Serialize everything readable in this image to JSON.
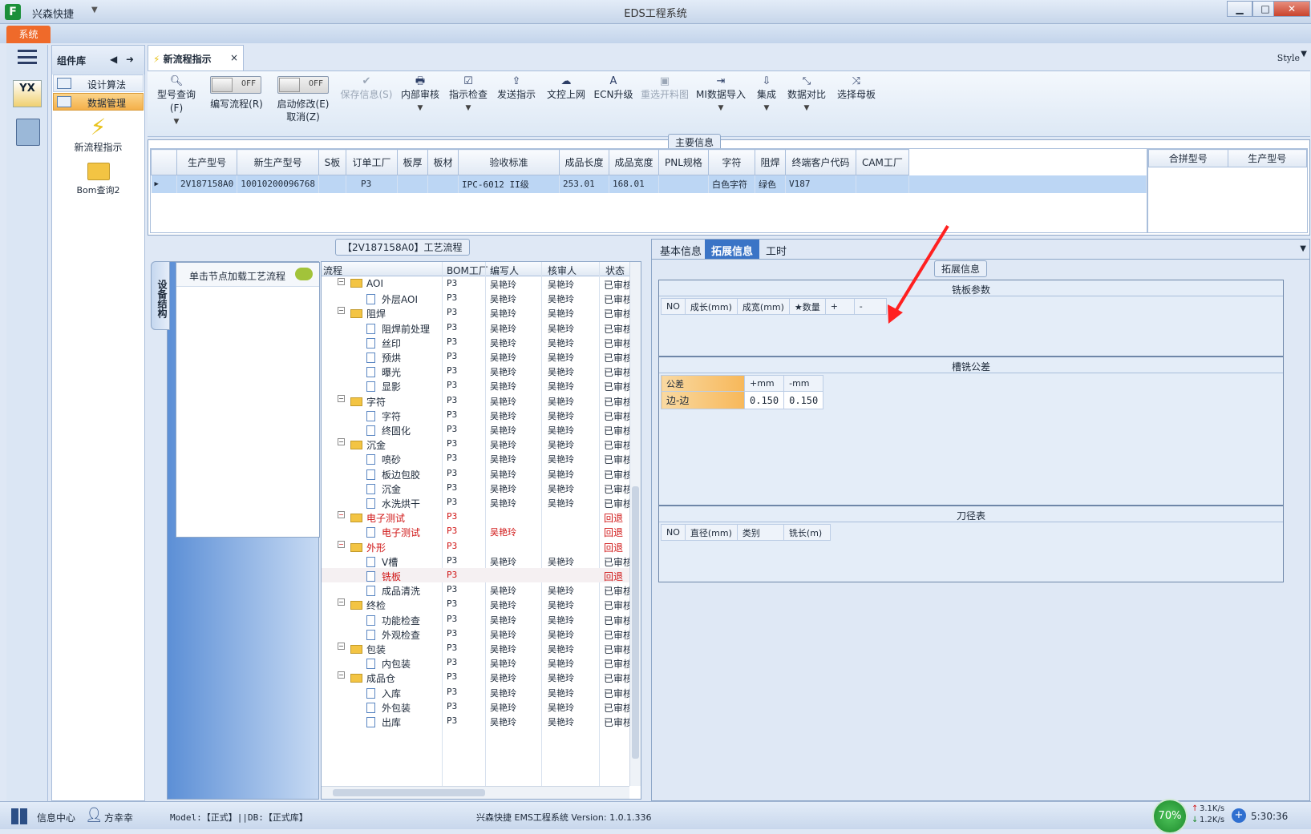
{
  "app": {
    "name": "兴森快捷",
    "window_title": "EDS工程系统",
    "menu_tab": "系统",
    "style_label": "Style"
  },
  "complib": {
    "title": "组件库",
    "items": [
      {
        "label": "设计算法"
      },
      {
        "label": "数据管理"
      }
    ],
    "big_items": [
      {
        "label": "新流程指示"
      },
      {
        "label": "Bom查询2"
      }
    ]
  },
  "doc_tab": {
    "label": "新流程指示",
    "close": "×"
  },
  "ribbon": {
    "buttons": [
      {
        "label": "型号查询(F)",
        "icon": "search-icon"
      },
      {
        "label": "编写流程(R)",
        "toggle": "OFF"
      },
      {
        "label": "启动修改(E)",
        "label2": "取消(Z)",
        "toggle": "OFF"
      },
      {
        "label": "保存信息(S)",
        "disabled": true
      },
      {
        "label": "内部审核"
      },
      {
        "label": "指示检查"
      },
      {
        "label": "发送指示"
      },
      {
        "label": "文控上网"
      },
      {
        "label": "ECN升级"
      },
      {
        "label": "重选开料图",
        "disabled": true
      },
      {
        "label": "MI数据导入"
      },
      {
        "label": "集成"
      },
      {
        "label": "数据对比"
      },
      {
        "label": "选择母板"
      }
    ]
  },
  "main_info": {
    "title": "主要信息",
    "columns": [
      "生产型号",
      "新生产型号",
      "S板",
      "订单工厂",
      "板厚",
      "板材",
      "验收标准",
      "成品长度",
      "成品宽度",
      "PNL规格",
      "字符",
      "阻焊",
      "终端客户代码",
      "CAM工厂"
    ],
    "row": [
      "2V187158A0",
      "10010200096768",
      "",
      "P3",
      "",
      "",
      "IPC-6012 II级",
      "253.01",
      "168.01",
      "",
      "白色字符",
      "绿色",
      "V187",
      ""
    ],
    "merge_columns": [
      "合拼型号",
      "生产型号"
    ]
  },
  "process": {
    "title": "【2V187158A0】工艺流程",
    "vertical_tab": "设备结构",
    "click_hint": "单击节点加载工艺流程",
    "columns": [
      "流程",
      "BOM工厂",
      "编写人",
      "核审人",
      "状态"
    ],
    "rows": [
      {
        "name": "AOI",
        "level": 0,
        "factory": "P3",
        "writer": "吴艳玲",
        "reviewer": "吴艳玲",
        "status": "已审核"
      },
      {
        "name": "外层AOI",
        "level": 1,
        "factory": "P3",
        "writer": "吴艳玲",
        "reviewer": "吴艳玲",
        "status": "已审核"
      },
      {
        "name": "阻焊",
        "level": 0,
        "factory": "P3",
        "writer": "吴艳玲",
        "reviewer": "吴艳玲",
        "status": "已审核"
      },
      {
        "name": "阻焊前处理",
        "level": 1,
        "factory": "P3",
        "writer": "吴艳玲",
        "reviewer": "吴艳玲",
        "status": "已审核"
      },
      {
        "name": "丝印",
        "level": 1,
        "factory": "P3",
        "writer": "吴艳玲",
        "reviewer": "吴艳玲",
        "status": "已审核"
      },
      {
        "name": "预烘",
        "level": 1,
        "factory": "P3",
        "writer": "吴艳玲",
        "reviewer": "吴艳玲",
        "status": "已审核"
      },
      {
        "name": "曝光",
        "level": 1,
        "factory": "P3",
        "writer": "吴艳玲",
        "reviewer": "吴艳玲",
        "status": "已审核"
      },
      {
        "name": "显影",
        "level": 1,
        "factory": "P3",
        "writer": "吴艳玲",
        "reviewer": "吴艳玲",
        "status": "已审核"
      },
      {
        "name": "字符",
        "level": 0,
        "factory": "P3",
        "writer": "吴艳玲",
        "reviewer": "吴艳玲",
        "status": "已审核"
      },
      {
        "name": "字符",
        "level": 1,
        "factory": "P3",
        "writer": "吴艳玲",
        "reviewer": "吴艳玲",
        "status": "已审核"
      },
      {
        "name": "终固化",
        "level": 1,
        "factory": "P3",
        "writer": "吴艳玲",
        "reviewer": "吴艳玲",
        "status": "已审核"
      },
      {
        "name": "沉金",
        "level": 0,
        "factory": "P3",
        "writer": "吴艳玲",
        "reviewer": "吴艳玲",
        "status": "已审核"
      },
      {
        "name": "喷砂",
        "level": 1,
        "factory": "P3",
        "writer": "吴艳玲",
        "reviewer": "吴艳玲",
        "status": "已审核"
      },
      {
        "name": "板边包胶",
        "level": 1,
        "factory": "P3",
        "writer": "吴艳玲",
        "reviewer": "吴艳玲",
        "status": "已审核"
      },
      {
        "name": "沉金",
        "level": 1,
        "factory": "P3",
        "writer": "吴艳玲",
        "reviewer": "吴艳玲",
        "status": "已审核"
      },
      {
        "name": "水洗烘干",
        "level": 1,
        "factory": "P3",
        "writer": "吴艳玲",
        "reviewer": "吴艳玲",
        "status": "已审核"
      },
      {
        "name": "电子测试",
        "level": 0,
        "factory": "P3",
        "writer": "",
        "reviewer": "",
        "status": "回退",
        "red": true
      },
      {
        "name": "电子测试",
        "level": 1,
        "factory": "P3",
        "writer": "吴艳玲",
        "reviewer": "",
        "status": "回退",
        "red": true
      },
      {
        "name": "外形",
        "level": 0,
        "factory": "P3",
        "writer": "",
        "reviewer": "",
        "status": "回退",
        "red": true
      },
      {
        "name": "V槽",
        "level": 1,
        "factory": "P3",
        "writer": "吴艳玲",
        "reviewer": "吴艳玲",
        "status": "已审核"
      },
      {
        "name": "铣板",
        "level": 1,
        "factory": "P3",
        "writer": "",
        "reviewer": "",
        "status": "回退",
        "red": true,
        "selected": true
      },
      {
        "name": "成品清洗",
        "level": 1,
        "factory": "P3",
        "writer": "吴艳玲",
        "reviewer": "吴艳玲",
        "status": "已审核"
      },
      {
        "name": "终检",
        "level": 0,
        "factory": "P3",
        "writer": "吴艳玲",
        "reviewer": "吴艳玲",
        "status": "已审核"
      },
      {
        "name": "功能检查",
        "level": 1,
        "factory": "P3",
        "writer": "吴艳玲",
        "reviewer": "吴艳玲",
        "status": "已审核"
      },
      {
        "name": "外观检查",
        "level": 1,
        "factory": "P3",
        "writer": "吴艳玲",
        "reviewer": "吴艳玲",
        "status": "已审核"
      },
      {
        "name": "包装",
        "level": 0,
        "factory": "P3",
        "writer": "吴艳玲",
        "reviewer": "吴艳玲",
        "status": "已审核"
      },
      {
        "name": "内包装",
        "level": 1,
        "factory": "P3",
        "writer": "吴艳玲",
        "reviewer": "吴艳玲",
        "status": "已审核"
      },
      {
        "name": "成品仓",
        "level": 0,
        "factory": "P3",
        "writer": "吴艳玲",
        "reviewer": "吴艳玲",
        "status": "已审核"
      },
      {
        "name": "入库",
        "level": 1,
        "factory": "P3",
        "writer": "吴艳玲",
        "reviewer": "吴艳玲",
        "status": "已审核"
      },
      {
        "name": "外包装",
        "level": 1,
        "factory": "P3",
        "writer": "吴艳玲",
        "reviewer": "吴艳玲",
        "status": "已审核"
      },
      {
        "name": "出库",
        "level": 1,
        "factory": "P3",
        "writer": "吴艳玲",
        "reviewer": "吴艳玲",
        "status": "已审核"
      }
    ]
  },
  "right": {
    "tabs": [
      "基本信息",
      "拓展信息",
      "工时"
    ],
    "active_tab": "拓展信息",
    "group_title": "拓展信息",
    "mill_params": {
      "title": "铣板参数",
      "columns": [
        "NO",
        "成长(mm)",
        "成宽(mm)",
        "★数量",
        "+",
        "-"
      ]
    },
    "slot_tol": {
      "title": "槽铣公差",
      "columns": [
        "公差",
        "+mm",
        "-mm"
      ],
      "row": [
        "边-边",
        "0.150",
        "0.150"
      ]
    },
    "tool_dia": {
      "title": "刀径表",
      "columns": [
        "NO",
        "直径(mm)",
        "类别",
        "铣长(m)"
      ]
    }
  },
  "status": {
    "info_center": "信息中心",
    "user": "方幸幸",
    "model": "Model:【正式】||DB:【正式库】",
    "version": "兴森快捷 EMS工程系统 Version: 1.0.1.336",
    "cpu": "70%",
    "up": "3.1K/s",
    "down": "1.2K/s",
    "time": "5:30:36"
  },
  "colors": {
    "accent": "#3a74c6",
    "annotation_arrow": "#ff2020",
    "reject_red": "#d01616",
    "menu_orange": "#ef6a2a"
  }
}
